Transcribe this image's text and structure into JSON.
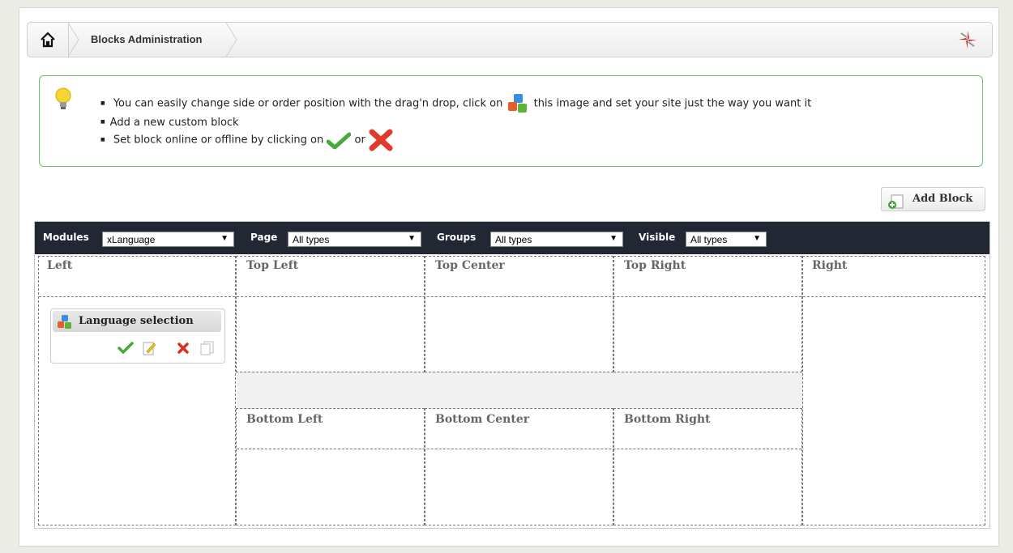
{
  "header": {
    "title": "Blocks Administration"
  },
  "info": {
    "items": [
      {
        "before": "You can easily change side or order position with the drag'n drop, click on",
        "after": "this image and set your site just the way you want it"
      },
      {
        "text": "Add a new custom block"
      },
      {
        "before": "Set block online or offline by clicking on",
        "middle": "or"
      }
    ]
  },
  "toolbar": {
    "add_block_label": "Add Block"
  },
  "filters": {
    "modules": {
      "label": "Modules",
      "value": "xLanguage"
    },
    "page": {
      "label": "Page",
      "value": "All types"
    },
    "groups": {
      "label": "Groups",
      "value": "All types"
    },
    "visible": {
      "label": "Visible",
      "value": "All types"
    }
  },
  "zones": {
    "left": "Left",
    "top_left": "Top Left",
    "top_center": "Top Center",
    "top_right": "Top Right",
    "right": "Right",
    "bottom_left": "Bottom Left",
    "bottom_center": "Bottom Center",
    "bottom_right": "Bottom Right"
  },
  "block": {
    "title": "Language selection"
  },
  "colors": {
    "success_border": "#67c467",
    "filter_bar": "#222833",
    "zone_text": "#666666"
  }
}
